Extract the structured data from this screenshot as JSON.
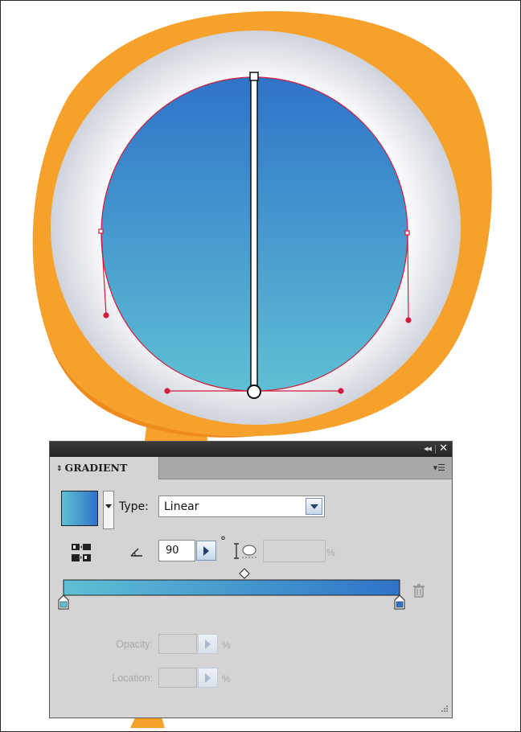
{
  "colors": {
    "gradient_start": "#5ec0d4",
    "gradient_end": "#2f73c8",
    "path_stroke": "#d01c3a",
    "rim_outer": "#f6a12c",
    "rim_inner": "#dfe2e8",
    "panel_bg": "#d4d4d4"
  },
  "panel": {
    "collapse_glyph": "◂◂",
    "close_glyph": "✕",
    "tab_arrows": "⇕",
    "tab_title": "GRADIENT",
    "menu_glyph": "▾☰",
    "type_label": "Type:",
    "type_value": "Linear",
    "angle_value": "90",
    "degree_sign": "°",
    "aspect_unit": "%",
    "opacity_label": "Opacity:",
    "opacity_unit": "%",
    "location_label": "Location:",
    "location_unit": "%"
  },
  "gradient_slider": {
    "stops": [
      {
        "location_percent": 0,
        "color": "#5ec0d4"
      },
      {
        "location_percent": 100,
        "color": "#2f73c8"
      }
    ],
    "midpoint_percent": 50
  }
}
